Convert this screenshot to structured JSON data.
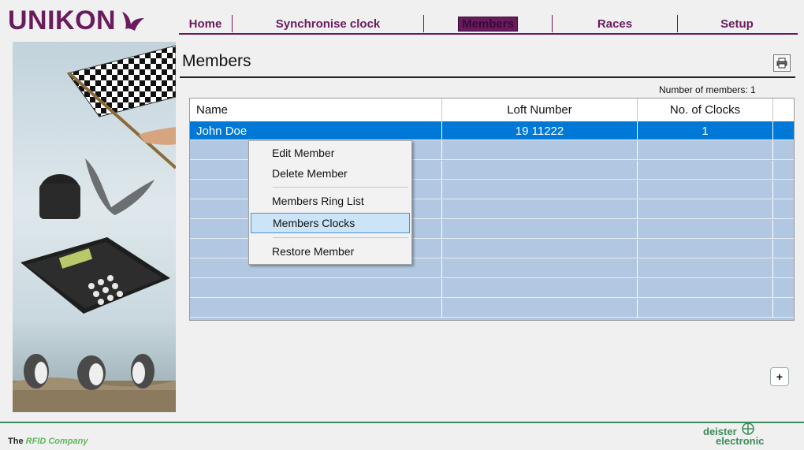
{
  "brand": {
    "logo_text": "UNIKON",
    "accent": "#6a1b5e",
    "footer_left_prefix": "The",
    "footer_left_highlight": "RFID Company",
    "footer_right_top": "deister",
    "footer_right_bottom": "electronic"
  },
  "nav": {
    "items": [
      "Home",
      "Synchronise clock",
      "Members",
      "Races",
      "Setup"
    ],
    "active": "Members"
  },
  "page": {
    "title": "Members",
    "member_count": "Number of members: 1"
  },
  "table": {
    "columns": [
      "Name",
      "Loft Number",
      "No. of Clocks"
    ],
    "rows": [
      {
        "name": "John Doe",
        "loft": "19 11222",
        "clocks": "1",
        "selected": true
      }
    ]
  },
  "context_menu": {
    "items": [
      "Edit Member",
      "Delete Member",
      "Members Ring List",
      "Members Clocks",
      "Restore Member"
    ],
    "highlighted": "Members Clocks"
  },
  "buttons": {
    "add_label": "+"
  },
  "icons": {
    "print": "printer-icon",
    "logo": "bird-logo-icon"
  }
}
